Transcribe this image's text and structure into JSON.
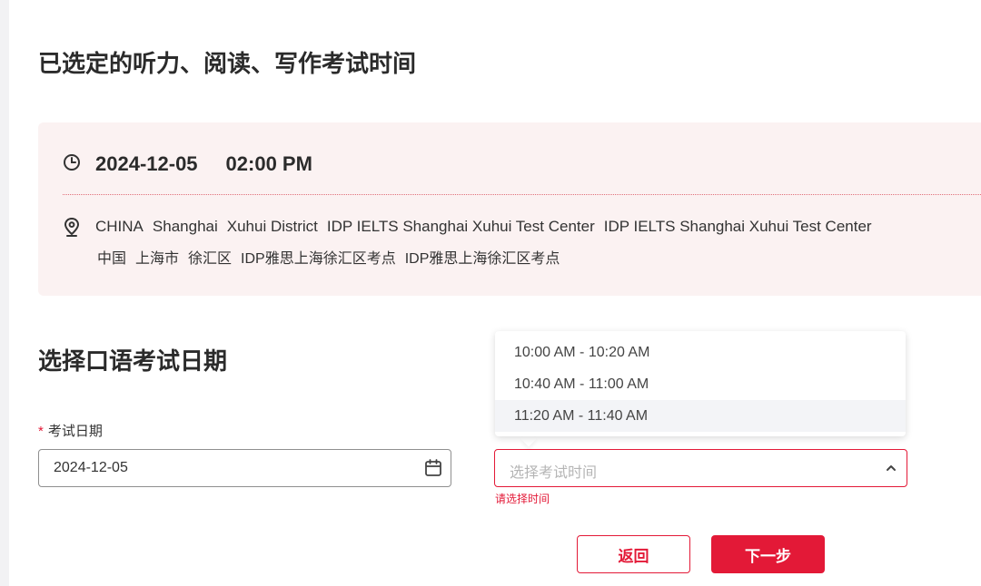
{
  "booked": {
    "title": "已选定的听力、阅读、写作考试时间",
    "date": "2024-12-05",
    "time": "02:00 PM",
    "location_en": [
      "CHINA",
      "Shanghai",
      "Xuhui District",
      "IDP IELTS Shanghai Xuhui Test Center",
      "IDP IELTS Shanghai Xuhui Test Center"
    ],
    "location_zh": [
      "中国",
      "上海市",
      "徐汇区",
      "IDP雅思上海徐汇区考点",
      "IDP雅思上海徐汇区考点"
    ]
  },
  "speaking": {
    "title": "选择口语考试日期",
    "date_label": "考试日期",
    "required_mark": "*",
    "date_value": "2024-12-05",
    "time_placeholder": "选择考试时间",
    "time_error": "请选择时间",
    "time_options": [
      "10:00 AM - 10:20 AM",
      "10:40 AM - 11:00 AM",
      "11:20 AM - 11:40 AM"
    ]
  },
  "buttons": {
    "back": "返回",
    "next": "下一步"
  },
  "colors": {
    "accent": "#e31937",
    "card_bg": "#fbf2f2",
    "option_hover": "#f3f4f7"
  },
  "icons": {
    "time": "clock-icon",
    "location": "location-pin-icon",
    "calendar": "calendar-icon",
    "select": "chevron-up-icon"
  }
}
